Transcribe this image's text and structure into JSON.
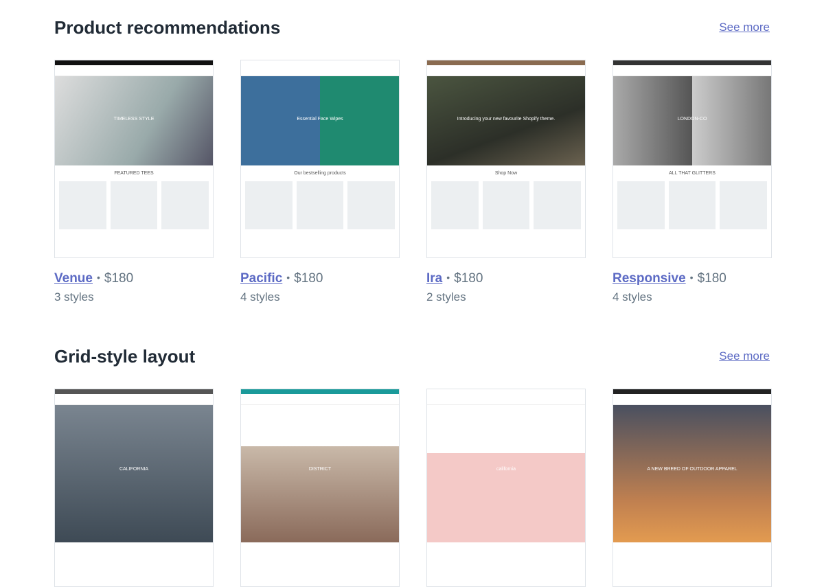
{
  "sections": [
    {
      "title": "Product recommendations",
      "see_more": "See more",
      "themes": [
        {
          "name": "Venue",
          "price": "$180",
          "styles": "3 styles",
          "thumb": {
            "top": "#111",
            "hero": "linear-gradient(120deg,#ddd,#9aa 60%,#556)",
            "hero_text": "TIMELESS STYLE",
            "body": "FEATURED TEES"
          }
        },
        {
          "name": "Pacific",
          "price": "$180",
          "styles": "4 styles",
          "thumb": {
            "top": "#fff",
            "hero": "linear-gradient(90deg,#3d6f9c 50%,#1f8a70 50%)",
            "hero_text": "Essential Face Wipes",
            "body": "Our bestselling products"
          }
        },
        {
          "name": "Ira",
          "price": "$180",
          "styles": "2 styles",
          "thumb": {
            "top": "#8a6b50",
            "hero": "linear-gradient(160deg,#4b5540,#2c2f28 60%,#6b6250)",
            "hero_text": "Introducing your new favourite Shopify theme.",
            "body": "Shop Now"
          }
        },
        {
          "name": "Responsive",
          "price": "$180",
          "styles": "4 styles",
          "thumb": {
            "top": "#333",
            "hero": "linear-gradient(90deg,#aaa,#555 50%,#ccc 50%,#777)",
            "hero_text": "LONDON-CO",
            "body": "ALL THAT GLITTERS"
          }
        }
      ]
    },
    {
      "title": "Grid-style layout",
      "see_more": "See more",
      "themes": [
        {
          "thumb": {
            "top": "#555",
            "hero": "linear-gradient(180deg,#7a8590,#3e4a55)",
            "hero_text": "CALIFORNIA"
          }
        },
        {
          "thumb": {
            "top": "#1a9a9a",
            "hero": "linear-gradient(180deg,#fff 30%,#c9b9a9 30%,#8a6a5a)",
            "hero_text": "DISTRICT"
          }
        },
        {
          "thumb": {
            "top": "#fff",
            "hero": "linear-gradient(180deg,#fff 35%,#f4c9c7 35%)",
            "hero_text": "california"
          }
        },
        {
          "thumb": {
            "top": "#222",
            "hero": "linear-gradient(180deg,#4a5060,#c08050 70%,#e39b50)",
            "hero_text": "A NEW BREED OF OUTDOOR APPAREL"
          }
        }
      ]
    }
  ],
  "colors": {
    "link": "#5c6ac4",
    "heading": "#212b36",
    "muted": "#637381"
  }
}
